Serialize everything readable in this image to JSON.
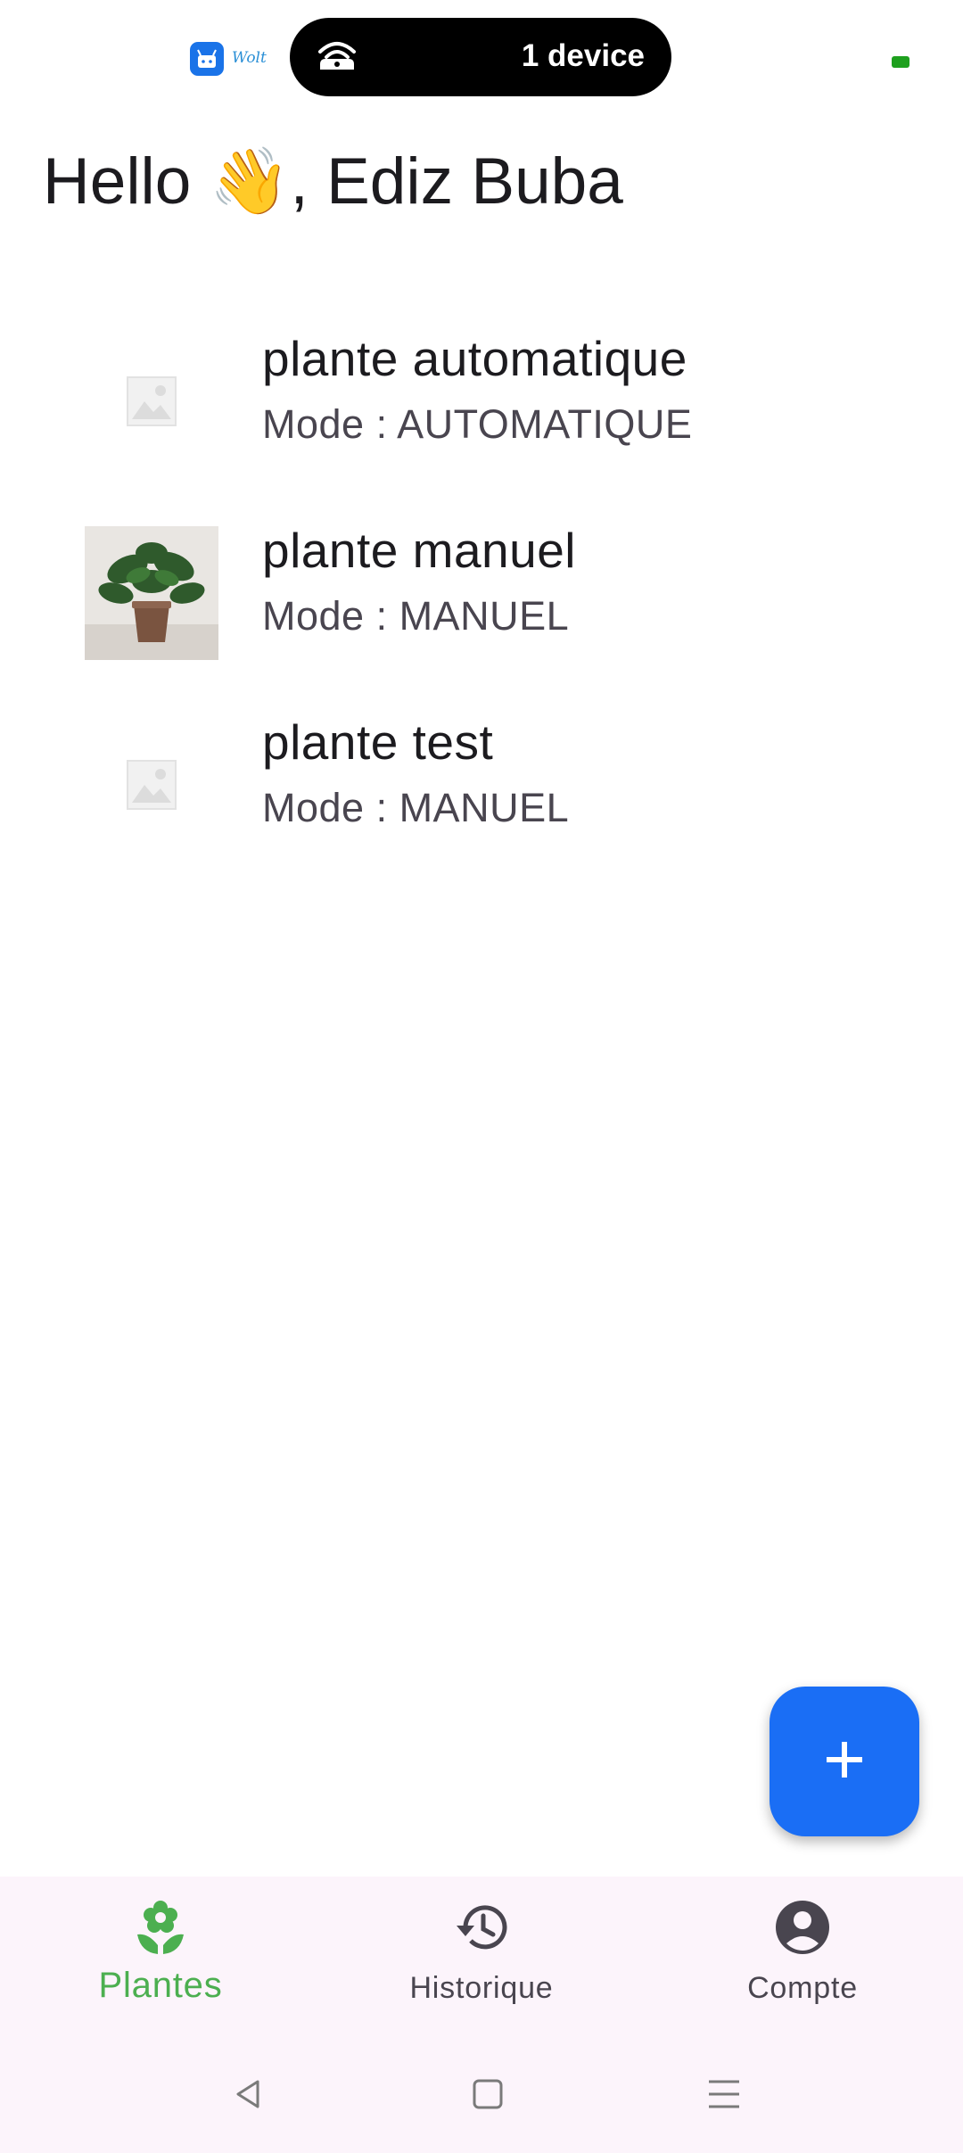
{
  "status_bar": {
    "app_badge_text": "Wolt",
    "device_pill_text": "1 device"
  },
  "greeting": {
    "text": "Hello 👋, Ediz Buba"
  },
  "plants": [
    {
      "title": "plante automatique",
      "mode": "Mode : AUTOMATIQUE",
      "thumbnail": "placeholder-image-icon"
    },
    {
      "title": "plante manuel",
      "mode": "Mode : MANUEL",
      "thumbnail": "plant-photo"
    },
    {
      "title": "plante test",
      "mode": "Mode : MANUEL",
      "thumbnail": "placeholder-image-icon"
    }
  ],
  "fab": {
    "icon": "plus-icon",
    "color": "#1a6ef5"
  },
  "bottom_nav": {
    "items": [
      {
        "label": "Plantes",
        "icon": "flower-icon",
        "active": true
      },
      {
        "label": "Historique",
        "icon": "history-icon",
        "active": false
      },
      {
        "label": "Compte",
        "icon": "account-icon",
        "active": false
      }
    ],
    "active_color": "#4caf50",
    "background": "#fcf4fb"
  },
  "system_nav": {
    "buttons": [
      "back-icon",
      "home-icon",
      "menu-icon"
    ]
  }
}
